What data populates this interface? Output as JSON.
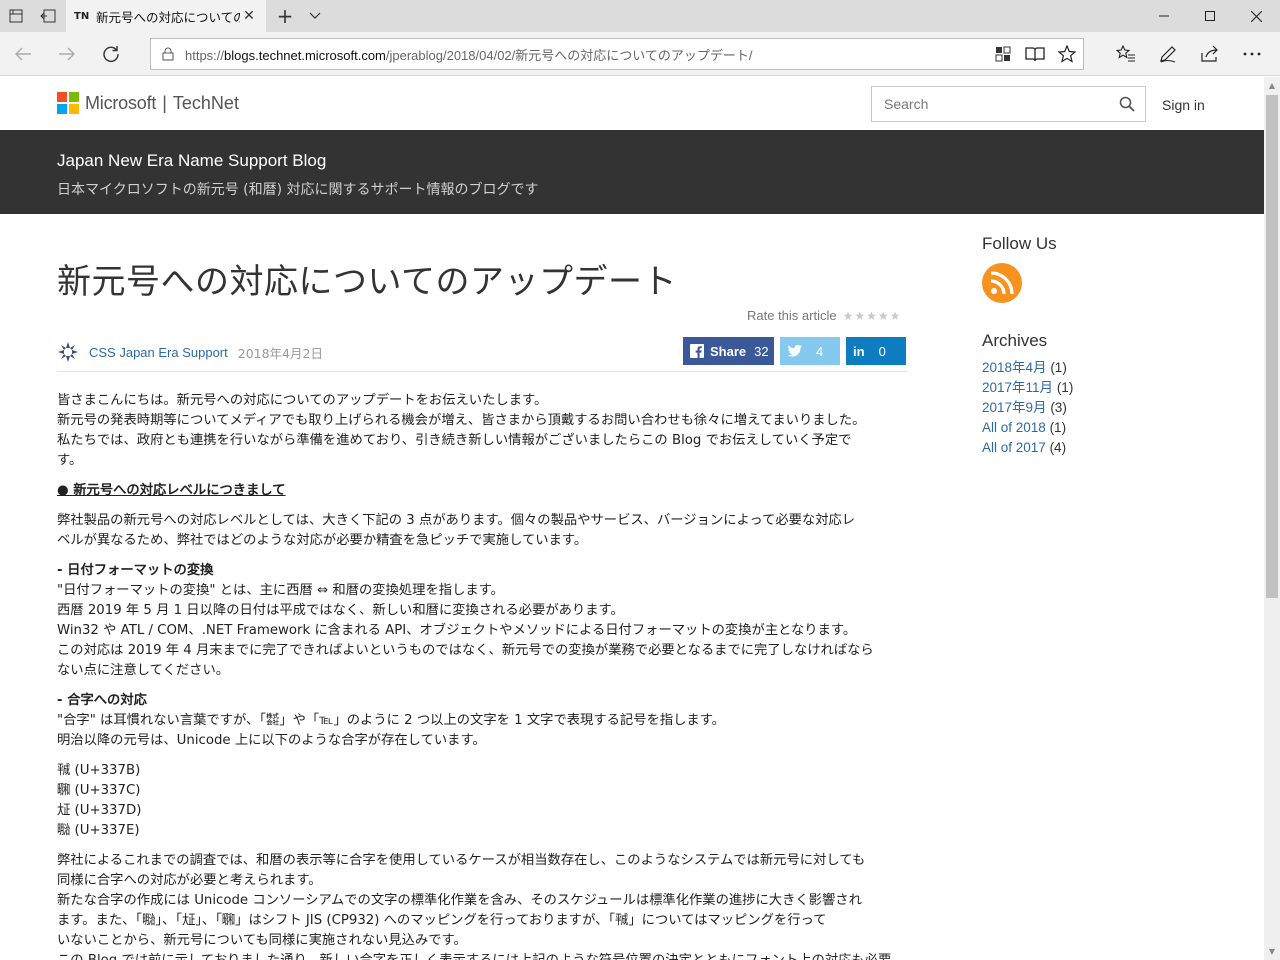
{
  "browser": {
    "tab_favicon": "TN",
    "tab_title": "新元号への対応についての",
    "address_prefix": "https://",
    "address_host": "blogs.technet.microsoft.com",
    "address_path": "/jperablog/2018/04/02/新元号への対応についてのアップデート/"
  },
  "header": {
    "brand": "Microsoft",
    "separator": "|",
    "site": "TechNet",
    "search_placeholder": "Search",
    "signin": "Sign in"
  },
  "banner": {
    "title": "Japan New Era Name Support Blog",
    "subtitle": "日本マイクロソフトの新元号 (和暦) 対応に関するサポート情報のブログです"
  },
  "article": {
    "title": "新元号への対応についてのアップデート",
    "rate_label": "Rate this article",
    "stars": "★★★★★",
    "author": "CSS Japan Era Support",
    "date": "2018年4月2日",
    "share": {
      "facebook_label": "Share",
      "facebook_count": "32",
      "twitter_count": "4",
      "linkedin_label": "in",
      "linkedin_count": "0"
    },
    "intro": [
      "皆さまこんにちは。新元号への対応についてのアップデートをお伝えいたします。",
      "新元号の発表時期等についてメディアでも取り上げられる機会が増え、皆さまから頂戴するお問い合わせも徐々に増えてまいりました。",
      "私たちでは、政府とも連携を行いながら準備を進めており、引き続き新しい情報がございましたらこの Blog でお伝えしていく予定で",
      "す。"
    ],
    "section_heading": "● 新元号への対応レベルにつきまして",
    "section_intro": [
      "弊社製品の新元号への対応レベルとしては、大きく下記の 3 点があります。個々の製品やサービス、バージョンによって必要な対応レ",
      "ベルが異なるため、弊社ではどのような対応が必要か精査を急ピッチで実施しています。"
    ],
    "date_format_heading": "- 日付フォーマットの変換",
    "date_format_lines": [
      "\"日付フォーマットの変換\" とは、主に西暦 ⇔ 和暦の変換処理を指します。",
      "西暦 2019 年 5 月 1 日以降の日付は平成ではなく、新しい和暦に変換される必要があります。",
      "Win32 や ATL / COM、.NET Framework に含まれる API、オブジェクトやメソッドによる日付フォーマットの変換が主となります。",
      "この対応は 2019 年 4 月末までに完了できればよいというものではなく、新元号での変換が業務で必要となるまでに完了しなければなら",
      "ない点に注意してください。"
    ],
    "ligature_heading": "- 合字への対応",
    "ligature_lines": [
      "\"合字\" は耳慣れない言葉ですが、「㍿」や「℡」のように 2 つ以上の文字を 1 文字で表現する記号を指します。",
      "明治以降の元号は、Unicode 上に以下のような合字が存在しています。"
    ],
    "ligatures": [
      "㍻ (U+337B)",
      "㍼ (U+337C)",
      "㍽ (U+337D)",
      "㍾ (U+337E)"
    ],
    "closing_lines": [
      "弊社によるこれまでの調査では、和暦の表示等に合字を使用しているケースが相当数存在し、このようなシステムでは新元号に対しても",
      "同様に合字への対応が必要と考えられます。",
      "新たな合字の作成には Unicode コンソーシアムでの文字の標準化作業を含み、そのスケジュールは標準化作業の進捗に大きく影響され",
      "ます。また、「㍾」、「㍽」、「㍼」はシフト JIS (CP932) へのマッピングを行っておりますが、「㍻」についてはマッピングを行って",
      "いないことから、新元号についても同様に実施されない見込みです。",
      "この Blog では前に示しておりました通り、新しい合字を正しく表示するには上記のような符号位置の決定とともにフォント上の対応も必要"
    ]
  },
  "sidebar": {
    "follow_heading": "Follow Us",
    "archives_heading": "Archives",
    "archives": [
      {
        "label": "2018年4月",
        "count": "(1)"
      },
      {
        "label": "2017年11月",
        "count": "(1)"
      },
      {
        "label": "2017年9月",
        "count": "(3)"
      },
      {
        "label": "All of 2018",
        "count": "(1)"
      },
      {
        "label": "All of 2017",
        "count": "(4)"
      }
    ]
  },
  "colors": {
    "banner_bg": "#333333",
    "link": "#2c6aa6",
    "facebook": "#3b5998",
    "twitter": "#86c9ee",
    "linkedin": "#0d7cc1",
    "rss": "#f7921e"
  },
  "icons": [
    "tab-manager-icon",
    "set-aside-icon",
    "close-icon",
    "plus-icon",
    "chevron-down-icon",
    "minimize-icon",
    "maximize-icon",
    "back-icon",
    "forward-icon",
    "refresh-icon",
    "lock-icon",
    "extension-icon",
    "reading-view-icon",
    "favorite-star-icon",
    "favorites-hub-icon",
    "pen-icon",
    "share-icon",
    "more-icon",
    "search-icon",
    "rss-icon"
  ]
}
